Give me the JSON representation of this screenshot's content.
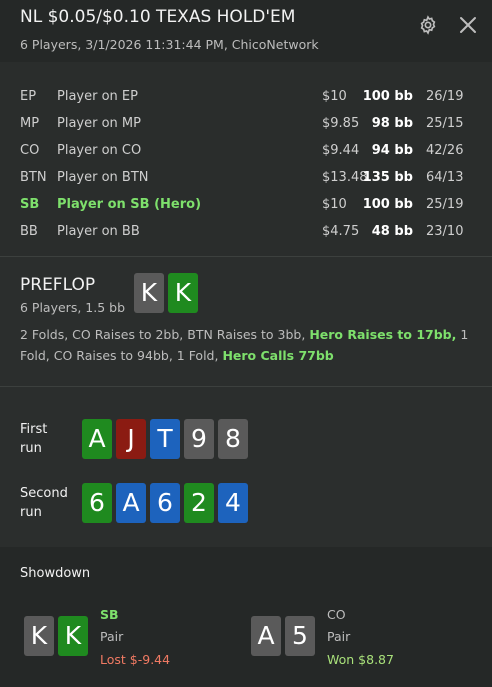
{
  "header": {
    "title": "NL $0.05/$0.10 TEXAS HOLD'EM",
    "subtitle": "6 Players, 3/1/2026 11:31:44 PM, ChicoNetwork"
  },
  "players": [
    {
      "pos": "EP",
      "name": "Player on EP",
      "stack": "$10",
      "bb": "100 bb",
      "stat": "26/19"
    },
    {
      "pos": "MP",
      "name": "Player on MP",
      "stack": "$9.85",
      "bb": "98 bb",
      "stat": "25/15"
    },
    {
      "pos": "CO",
      "name": "Player on CO",
      "stack": "$9.44",
      "bb": "94 bb",
      "stat": "42/26"
    },
    {
      "pos": "BTN",
      "name": "Player on BTN",
      "stack": "$13.48",
      "bb": "135 bb",
      "stat": "64/13"
    },
    {
      "pos": "SB",
      "name": "Player on SB (Hero)",
      "stack": "$10",
      "bb": "100 bb",
      "stat": "25/19"
    },
    {
      "pos": "BB",
      "name": "Player on BB",
      "stack": "$4.75",
      "bb": "48 bb",
      "stat": "23/10"
    }
  ],
  "preflop": {
    "title": "PREFLOP",
    "subtitle": "6 Players, 1.5 bb",
    "hero_cards": [
      "K",
      "K"
    ],
    "actions": {
      "a1": "2 Folds, CO Raises to 2bb, BTN Raises to 3bb, ",
      "a2": "Hero Raises to 17bb,",
      "a3": " 1 Fold, CO Raises to 94bb, 1 Fold, ",
      "a4": "Hero Calls 77bb"
    }
  },
  "runs": [
    {
      "label_1": "First",
      "label_2": "run",
      "cards": [
        "A",
        "J",
        "T",
        "9",
        "8"
      ]
    },
    {
      "label_1": "Second",
      "label_2": "run",
      "cards": [
        "6",
        "A",
        "6",
        "2",
        "4"
      ]
    }
  ],
  "showdown": {
    "title": "Showdown",
    "hands": [
      {
        "cards": [
          "K",
          "K"
        ],
        "pos": "SB",
        "hand": "Pair",
        "result": "Lost $-9.44"
      },
      {
        "cards": [
          "A",
          "5"
        ],
        "pos": "CO",
        "hand": "Pair",
        "result": "Won $8.87"
      }
    ]
  },
  "colors": {
    "background": "#2b2e2d",
    "header_bg": "#252827",
    "hero_green": "#7ee06c",
    "lost_red": "#f07a63",
    "won_green": "#a8e07a",
    "card_gray": "#5a5a5a",
    "card_green_clubs": "#1f8a1f",
    "card_red_hearts": "#8b1b12",
    "card_blue_diamonds": "#1d63bd"
  },
  "icons": [
    "gear-icon",
    "close-icon"
  ]
}
